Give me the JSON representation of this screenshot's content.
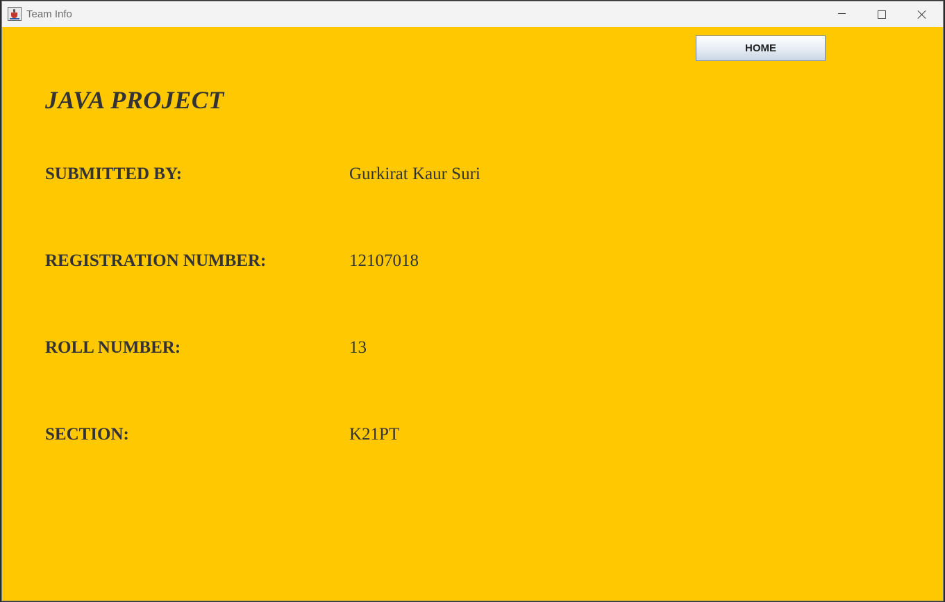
{
  "window": {
    "title": "Team Info",
    "icon": "java-cup-icon"
  },
  "toolbar": {
    "home_label": "HOME"
  },
  "main": {
    "project_title": "JAVA PROJECT",
    "rows": [
      {
        "label": "SUBMITTED BY:",
        "value": "Gurkirat Kaur Suri"
      },
      {
        "label": "REGISTRATION NUMBER:",
        "value": "12107018"
      },
      {
        "label": "ROLL NUMBER:",
        "value": "13"
      },
      {
        "label": "SECTION:",
        "value": "K21PT"
      }
    ]
  },
  "colors": {
    "background": "#ffc800",
    "text": "#333333",
    "titlebar": "#f3f3f3"
  }
}
